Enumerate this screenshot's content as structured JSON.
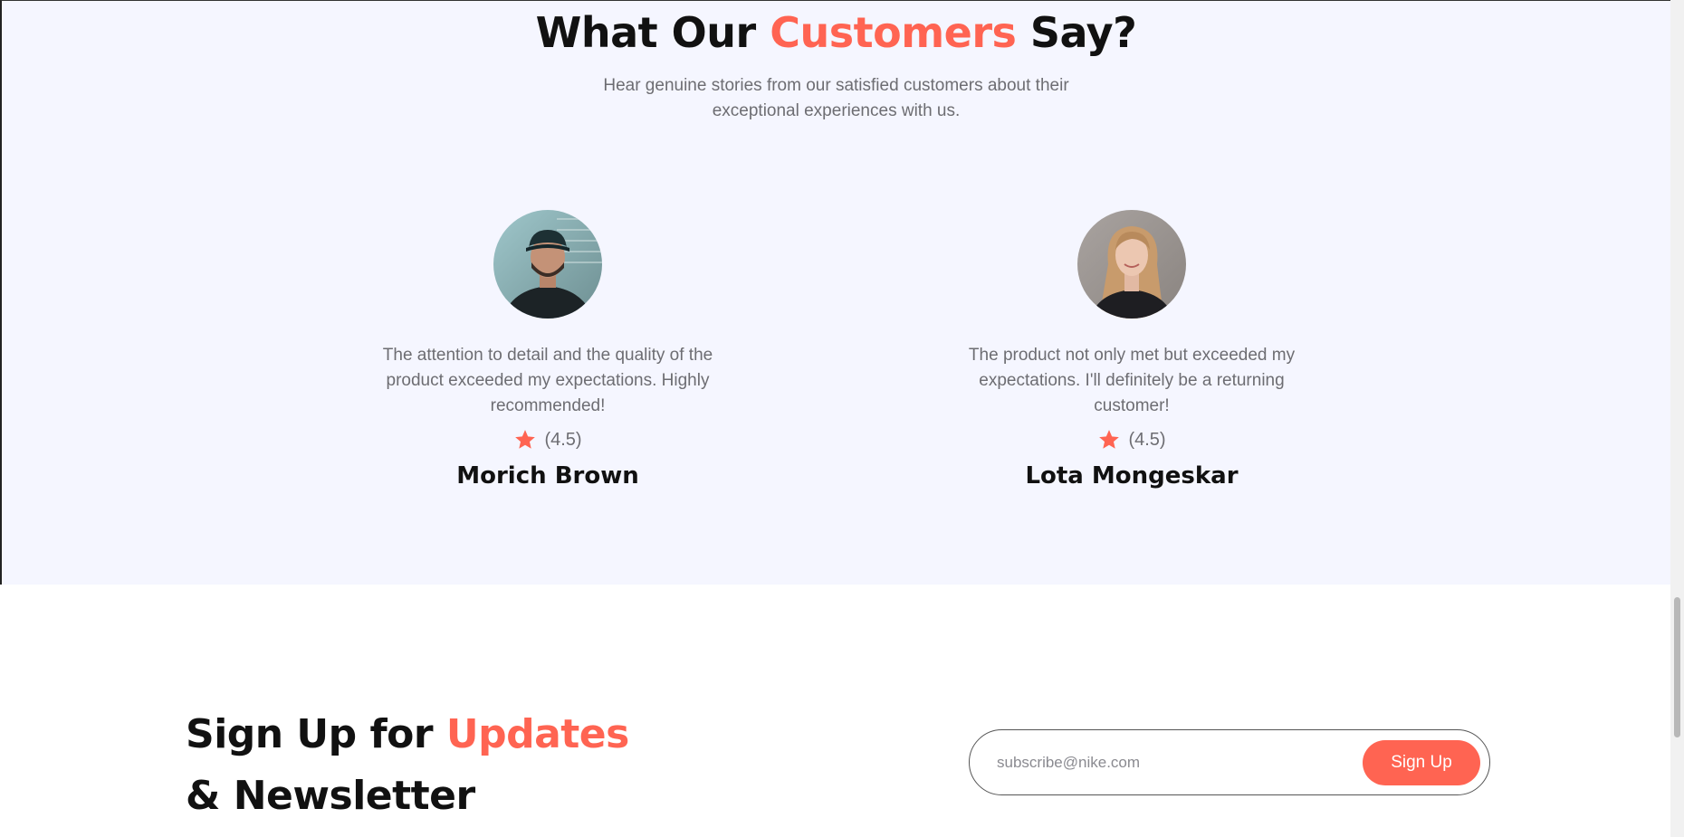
{
  "testimonials": {
    "title_part1": "What Our ",
    "title_accent": "Customers",
    "title_part2": " Say?",
    "subtitle": "Hear genuine stories from our satisfied customers about their exceptional experiences with us.",
    "items": [
      {
        "quote": "The attention to detail and the quality of the product exceeded my expectations. Highly recommended!",
        "rating": "(4.5)",
        "name": "Morich Brown",
        "avatar_icon": "avatar-man-cap"
      },
      {
        "quote": "The product not only met but exceeded my expectations. I'll definitely be a returning customer!",
        "rating": "(4.5)",
        "name": "Lota Mongeskar",
        "avatar_icon": "avatar-woman"
      }
    ]
  },
  "newsletter": {
    "title_part1": "Sign Up for ",
    "title_accent": "Updates",
    "title_line2": "& Newsletter",
    "input_placeholder": "subscribe@nike.com",
    "button_label": "Sign Up"
  },
  "colors": {
    "accent": "#ff6452",
    "section_bg": "#f5f6ff",
    "text_muted": "#6d6d72",
    "text_dark": "#111111"
  }
}
